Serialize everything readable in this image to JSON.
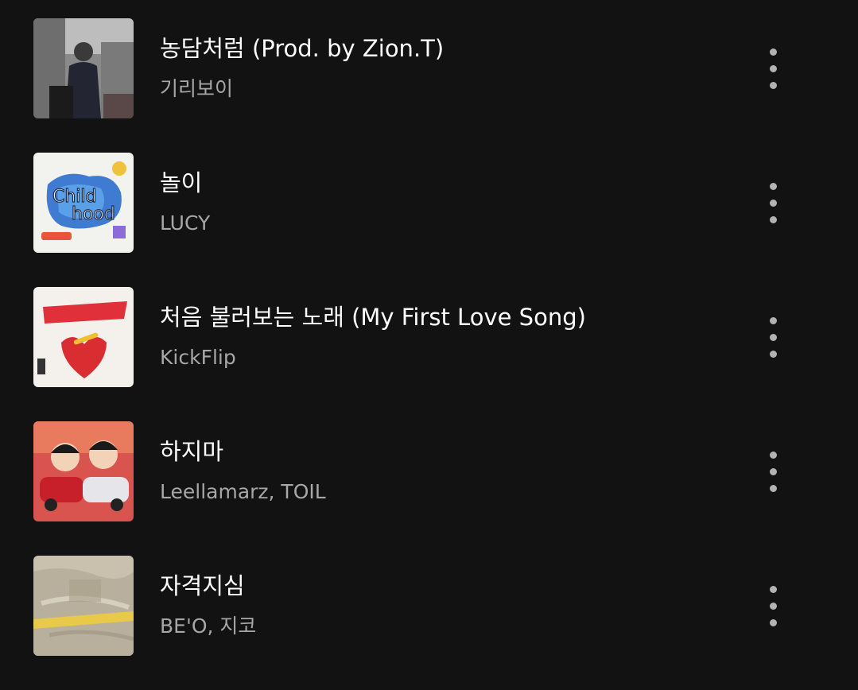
{
  "tracks": [
    {
      "title": "농담처럼 (Prod. by Zion.T)",
      "artist": "기리보이",
      "cover_icon": "album-cover-image",
      "menu_icon": "more-vertical-icon"
    },
    {
      "title": "놀이",
      "artist": "LUCY",
      "cover_icon": "album-cover-image",
      "menu_icon": "more-vertical-icon"
    },
    {
      "title": "처음 불러보는 노래 (My First Love Song)",
      "artist": "KickFlip",
      "cover_icon": "album-cover-image",
      "menu_icon": "more-vertical-icon"
    },
    {
      "title": "하지마",
      "artist": "Leellamarz, TOIL",
      "cover_icon": "album-cover-image",
      "menu_icon": "more-vertical-icon"
    },
    {
      "title": "자격지심",
      "artist": "BE'O, 지코",
      "cover_icon": "album-cover-image",
      "menu_icon": "more-vertical-icon"
    }
  ],
  "colors": {
    "background": "#121212",
    "title": "#ffffff",
    "artist": "#a7a7a7",
    "menu_dots": "#b3b3b3"
  }
}
